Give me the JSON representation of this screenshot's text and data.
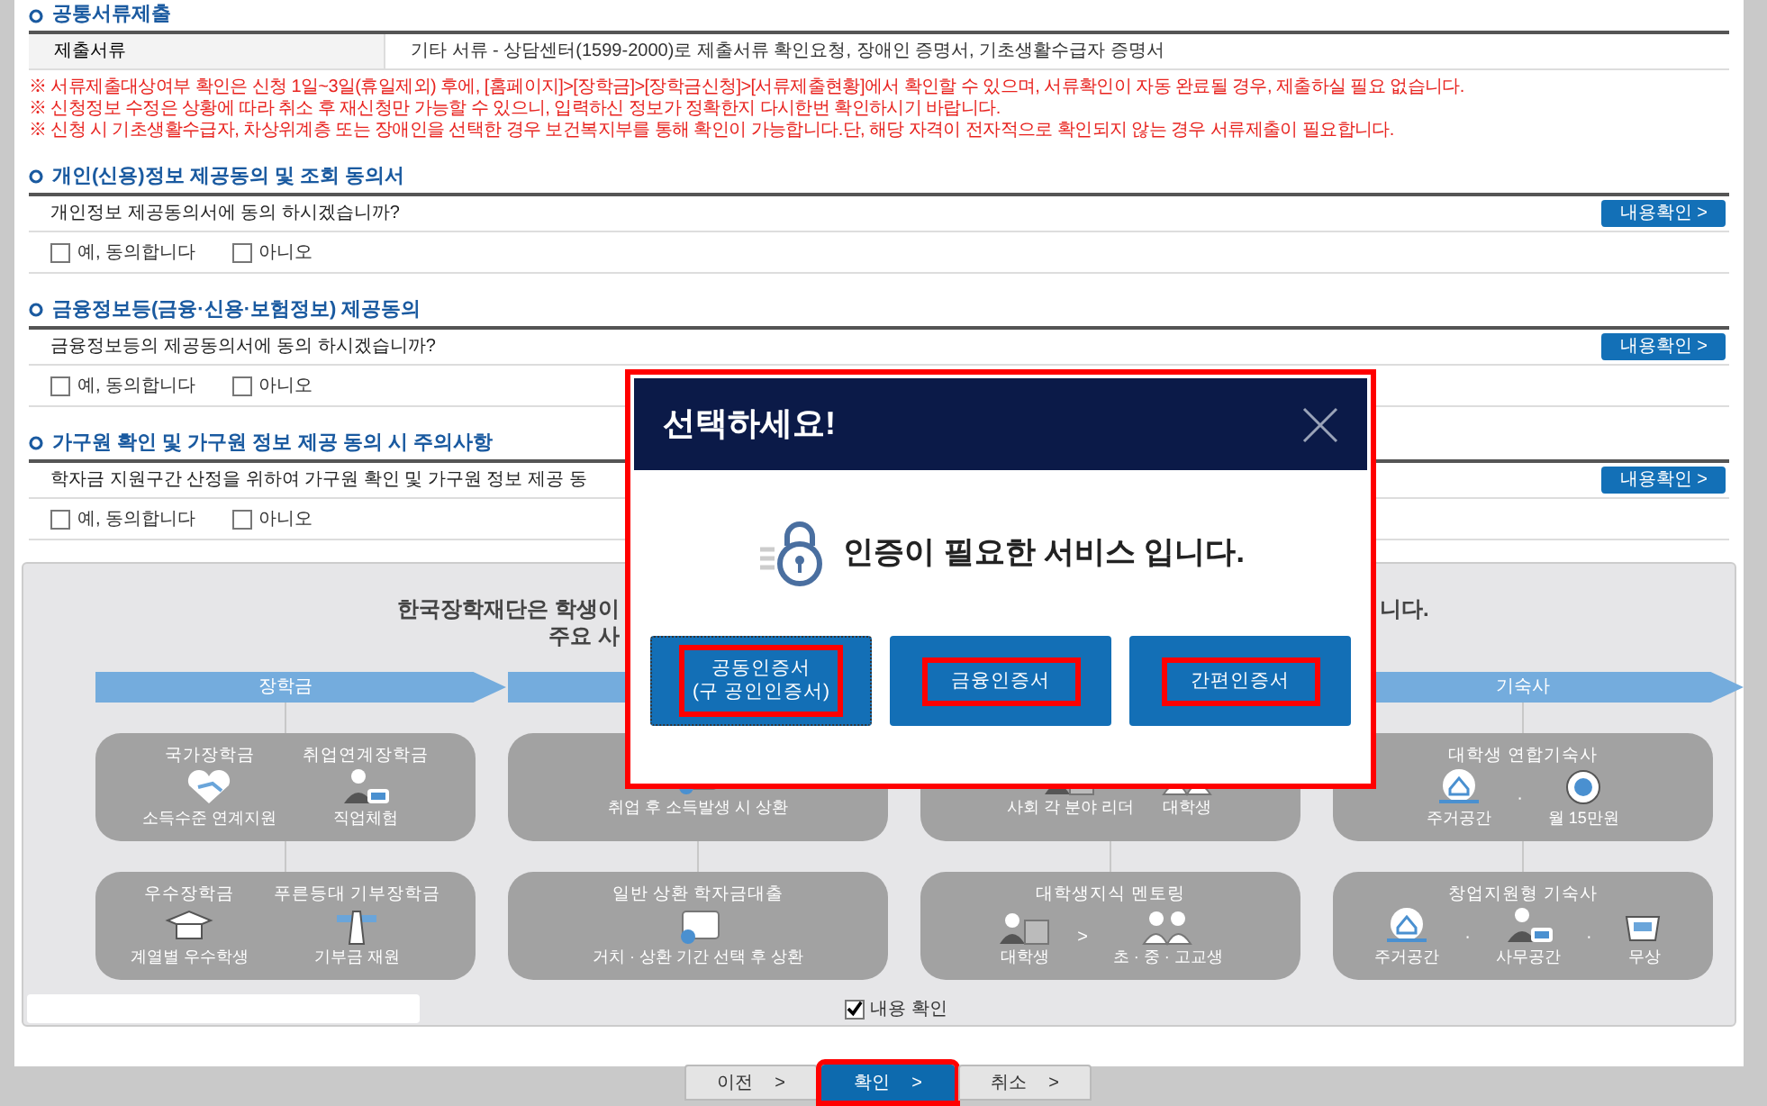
{
  "documents": {
    "title": "공통서류제출",
    "label": "제출서류",
    "value": "기타 서류 - 상담센터(1599-2000)로 제출서류 확인요청, 장애인 증명서, 기초생활수급자 증명서",
    "notes": [
      "※ 서류제출대상여부 확인은 신청 1일~3일(휴일제외) 후에, [홈페이지]>[장학금]>[장학금신청]>[서류제출현황]에서 확인할 수 있으며, 서류확인이 자동 완료될 경우, 제출하실 필요 없습니다.",
      "※ 신청정보 수정은 상황에 따라 취소 후 재신청만 가능할 수 있으니, 입력하신 정보가 정확한지 다시한번 확인하시기 바랍니다.",
      "※ 신청 시 기초생활수급자, 차상위계층 또는 장애인을 선택한 경우 보건복지부를 통해 확인이 가능합니다.단, 해당 자격이 전자적으로 확인되지 않는 경우 서류제출이 필요합니다."
    ]
  },
  "consents": [
    {
      "title": "개인(신용)정보 제공동의 및 조회 동의서",
      "question": "개인정보 제공동의서에 동의 하시겠습니까?",
      "button": "내용확인",
      "button_arrow": ">",
      "options": [
        {
          "label": "예, 동의합니다",
          "checked": false
        },
        {
          "label": "아니오",
          "checked": false
        }
      ]
    },
    {
      "title": "금융정보등(금융·신용·보험정보) 제공동의",
      "question": "금융정보등의 제공동의서에 동의 하시겠습니까?",
      "button": "내용확인",
      "button_arrow": ">",
      "options": [
        {
          "label": "예, 동의합니다",
          "checked": false
        },
        {
          "label": "아니오",
          "checked": false
        }
      ]
    },
    {
      "title": "가구원 확인 및 가구원 정보 제공 동의 시 주의사항",
      "question": "학자금 지원구간 산정을 위하여 가구원 확인 및 가구원 정보 제공 동",
      "button": "내용확인",
      "button_arrow": ">",
      "options": [
        {
          "label": "예, 동의합니다",
          "checked": false
        },
        {
          "label": "아니오",
          "checked": false
        }
      ]
    }
  ],
  "infographic": {
    "headline_left": "한국장학재단은 학생이",
    "headline_right": "니다.",
    "subline_left": "주요 사",
    "columns": [
      {
        "header": "장학금",
        "cards": [
          {
            "items": [
              {
                "title": "국가장학금",
                "label": "소득수준 연계지원"
              },
              {
                "title": "취업연계장학금",
                "label": "직업체험"
              }
            ]
          },
          {
            "items": [
              {
                "title": "우수장학금",
                "label": "계열별 우수학생"
              },
              {
                "title": "푸른등대 기부장학금",
                "label": "기부금 재원"
              }
            ]
          }
        ]
      },
      {
        "cards": [
          {
            "items": [
              {
                "label": "취업 후 소득발생 시 상환"
              }
            ]
          },
          {
            "title": "일반 상환 학자금대출",
            "items": [
              {
                "label": "거치 · 상환 기간 선택 후 상환"
              }
            ]
          }
        ]
      },
      {
        "cards": [
          {
            "items": [
              {
                "label": "사회 각 분야 리더"
              },
              {
                "label": "대학생"
              }
            ]
          },
          {
            "title": "대학생지식 멘토링",
            "separator": ">",
            "items": [
              {
                "label": "대학생"
              },
              {
                "label": "초 · 중 · 고교생"
              }
            ]
          }
        ]
      },
      {
        "header": "기숙사",
        "cards": [
          {
            "title": "대학생 연합기숙사",
            "separator": "·",
            "items": [
              {
                "label": "주거공간"
              },
              {
                "label": "월 15만원"
              }
            ]
          },
          {
            "title": "창업지원형 기숙사",
            "separator": "·",
            "items": [
              {
                "label": "주거공간"
              },
              {
                "label": "사무공간"
              },
              {
                "label": "무상"
              }
            ]
          }
        ]
      }
    ]
  },
  "confirm": {
    "label": "내용 확인",
    "checked": true
  },
  "buttons": [
    {
      "label": "이전",
      "arrow": ">",
      "primary": false,
      "highlighted": false
    },
    {
      "label": "확인",
      "arrow": ">",
      "primary": true,
      "highlighted": true
    },
    {
      "label": "취소",
      "arrow": ">",
      "primary": false,
      "highlighted": false
    }
  ],
  "modal": {
    "title": "선택하세요!",
    "message": "인증이 필요한 서비스 입니다.",
    "highlighted": true,
    "options": [
      {
        "label": "공동인증서\n(구 공인인증서)",
        "highlighted": true,
        "focused": true
      },
      {
        "label": "금융인증서",
        "highlighted": true,
        "focused": false
      },
      {
        "label": "간편인증서",
        "highlighted": true,
        "focused": false
      }
    ]
  }
}
